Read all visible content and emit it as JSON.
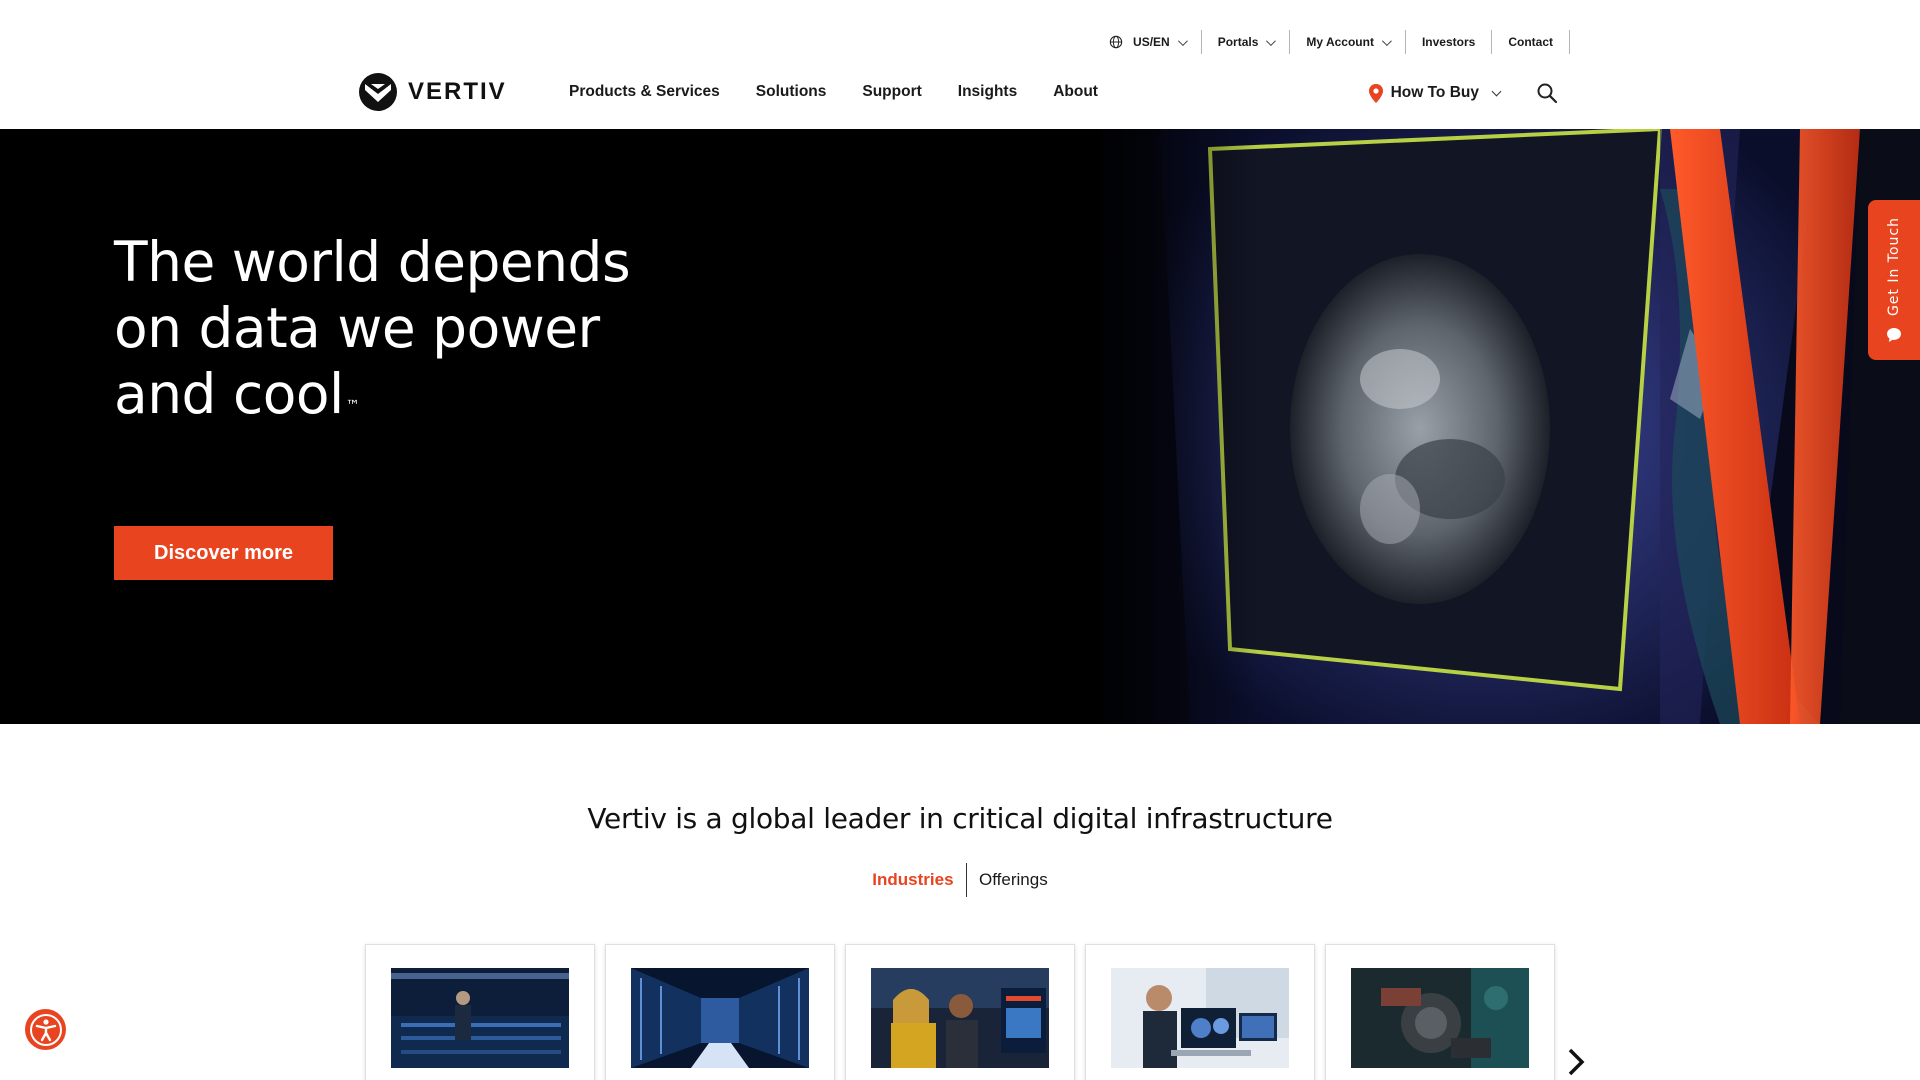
{
  "utility_nav": {
    "locale": "US/EN",
    "portals": "Portals",
    "my_account": "My Account",
    "investors": "Investors",
    "contact": "Contact"
  },
  "header": {
    "logo_text": "VERTIV",
    "nav": [
      "Products & Services",
      "Solutions",
      "Support",
      "Insights",
      "About"
    ],
    "how_to_buy": "How To Buy"
  },
  "hero": {
    "title_line1": "The world depends",
    "title_line2": "on data we power",
    "title_line3": "and cool",
    "trademark": "™",
    "cta": "Discover more"
  },
  "side_tab": {
    "label": "Get In Touch"
  },
  "section": {
    "title": "Vertiv is a global leader in critical digital infrastructure",
    "tabs": [
      {
        "label": "Industries",
        "active": true
      },
      {
        "label": "Offerings",
        "active": false
      }
    ]
  },
  "colors": {
    "accent": "#e8441f",
    "hero_bg": "#000000",
    "text": "#1a1a1a"
  },
  "icons": {
    "globe": "globe-icon",
    "pin": "location-pin-icon",
    "search": "search-icon",
    "chat": "chat-bubble-icon",
    "accessibility": "accessibility-icon",
    "next": "chevron-right-icon"
  }
}
